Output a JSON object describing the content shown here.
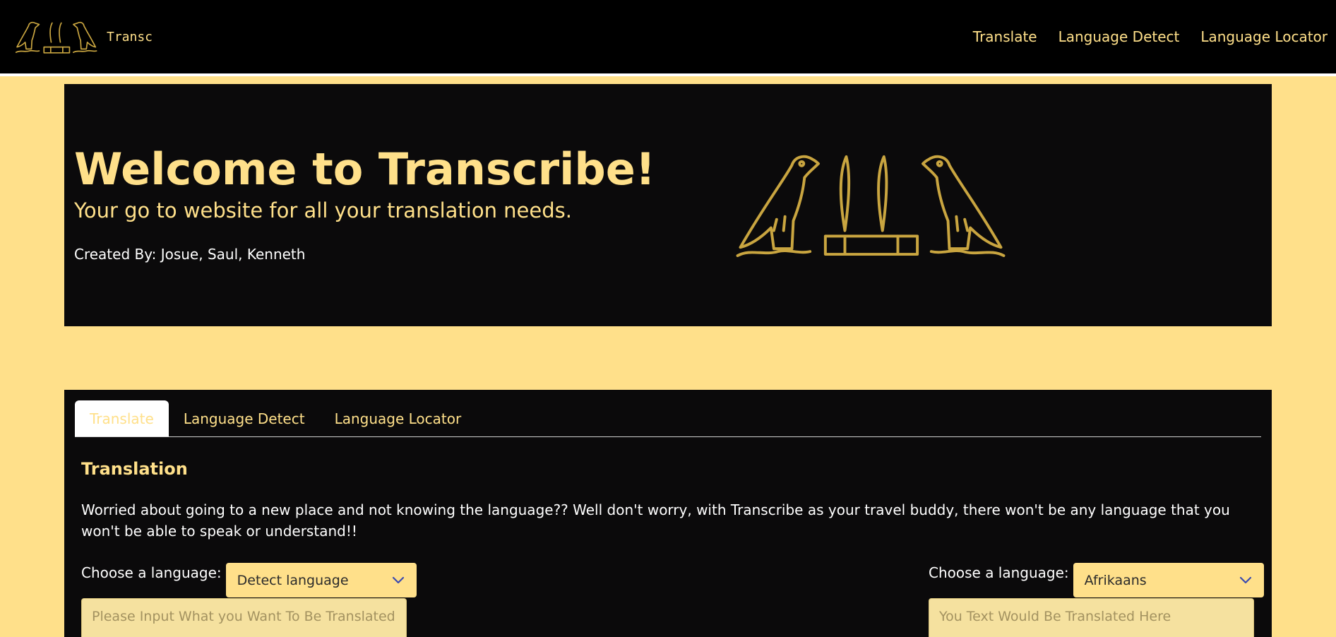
{
  "nav": {
    "brand": "Transc",
    "links": [
      "Translate",
      "Language Detect",
      "Language Locator"
    ]
  },
  "hero": {
    "title": "Welcome to Transcribe!",
    "subtitle": "Your go to website for all your translation needs.",
    "credits": "Created By: Josue, Saul, Kenneth"
  },
  "tabs": [
    "Translate",
    "Language Detect",
    "Language Locator"
  ],
  "active_tab": "Translate",
  "translation": {
    "title": "Translation",
    "description": "Worried about going to a new place and not knowing the language?? Well don't worry, with Transcribe as your travel buddy, there won't be any language that you won't be able to speak or understand!!",
    "source_label": "Choose a language:",
    "source_selected": "Detect language",
    "target_label": "Choose a language:",
    "target_selected": "Afrikaans",
    "input_placeholder": "Please Input What you Want To Be Translated",
    "output_placeholder": "You Text Would Be Translated Here"
  },
  "colors": {
    "accent_gold": "#ffe08a",
    "logo_gold": "#c9a540",
    "panel_black": "#0b0a0b",
    "nav_black": "#000000"
  }
}
